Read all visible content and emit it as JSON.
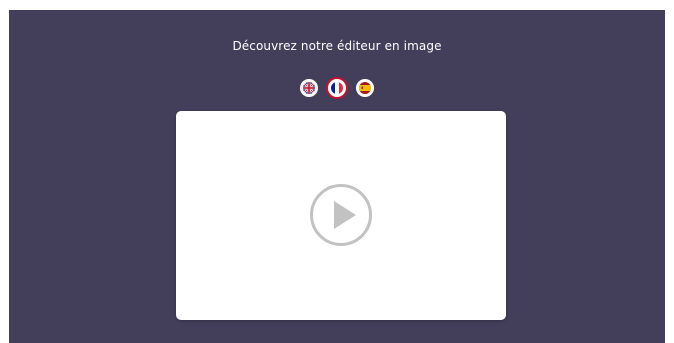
{
  "headline": "Découvrez notre éditeur en image",
  "languages": [
    {
      "code": "en",
      "icon": "uk-flag-icon",
      "active": false
    },
    {
      "code": "fr",
      "icon": "france-flag-icon",
      "active": true
    },
    {
      "code": "es",
      "icon": "spain-flag-icon",
      "active": false
    }
  ],
  "colors": {
    "background": "#433e5a",
    "card": "#ffffff",
    "play_icon": "#c2c2c2",
    "active_flag_ring": "#c8102e"
  },
  "video": {
    "icon": "play-icon"
  }
}
